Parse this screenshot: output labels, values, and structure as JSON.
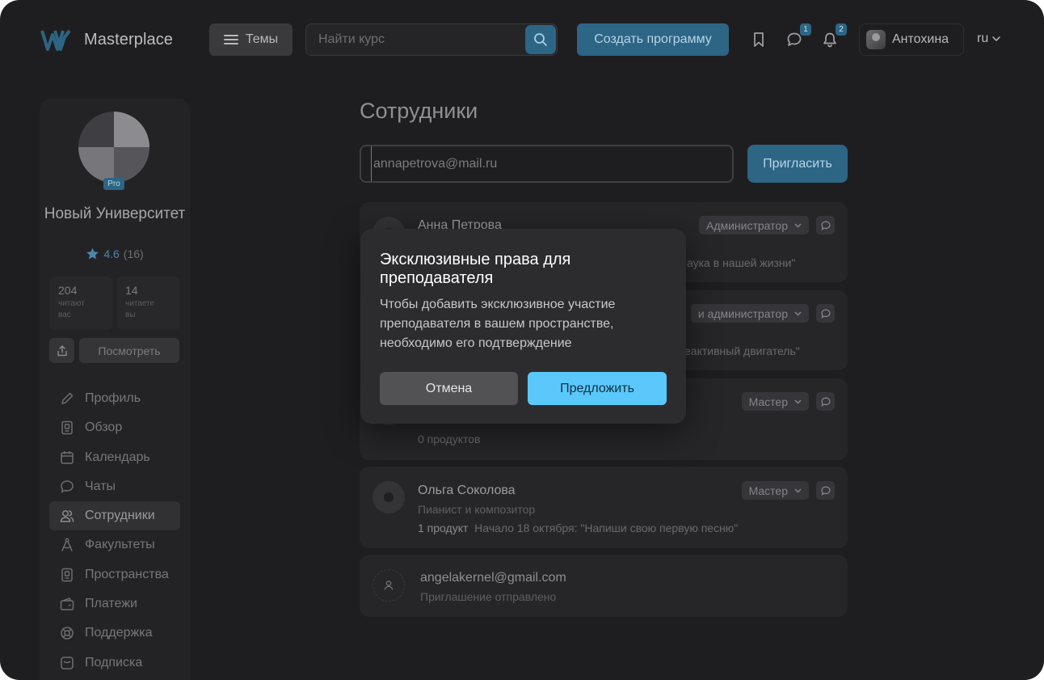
{
  "app": {
    "name": "Masterplace"
  },
  "header": {
    "themes_label": "Темы",
    "search_placeholder": "Найти курс",
    "create_label": "Создать программу",
    "messages_badge": "1",
    "notifications_badge": "2",
    "user_name": "Антохина",
    "lang": "ru"
  },
  "sidebar": {
    "pro_label": "Pro",
    "university_name": "Новый Университет",
    "rating": "4.6",
    "rating_count": "(16)",
    "stats": [
      {
        "num": "204",
        "label": "читают вас"
      },
      {
        "num": "14",
        "label": "читаете вы"
      }
    ],
    "view_label": "Посмотреть",
    "nav": [
      {
        "label": "Профиль",
        "icon": "pencil-icon"
      },
      {
        "label": "Обзор",
        "icon": "overview-icon"
      },
      {
        "label": "Календарь",
        "icon": "calendar-icon"
      },
      {
        "label": "Чаты",
        "icon": "chat-icon"
      },
      {
        "label": "Сотрудники",
        "icon": "users-icon",
        "active": true
      },
      {
        "label": "Факультеты",
        "icon": "compass-icon"
      },
      {
        "label": "Пространства",
        "icon": "space-icon"
      },
      {
        "label": "Платежи",
        "icon": "wallet-icon"
      },
      {
        "label": "Поддержка",
        "icon": "lifebuoy-icon"
      },
      {
        "label": "Подписка",
        "icon": "subscription-icon"
      }
    ]
  },
  "main": {
    "title": "Сотрудники",
    "invite_value": "annapetrova@mail.ru",
    "invite_label": "Пригласить",
    "employees": [
      {
        "name": "Анна Петрова",
        "role": "Администратор",
        "meta_tail": "аука в нашей жизни\""
      },
      {
        "role": "и администратор",
        "meta_tail": "еактивный двигатель\""
      },
      {
        "role": "Мастер",
        "meta_full": "0 продуктов"
      },
      {
        "name": "Ольга Соколова",
        "role": "Мастер",
        "subtitle": "Пианист и композитор",
        "products": "1 продукт",
        "meta": "Начало 18 октября: \"Напиши свою первую песню\""
      }
    ],
    "pending": {
      "email": "angelakernel@gmail.com",
      "status": "Приглашение отправлено"
    }
  },
  "modal": {
    "title": "Эксклюзивные права для преподавателя",
    "body": "Чтобы добавить эксклюзивное участие преподавателя в вашем пространстве, необходимо его подтверждение",
    "cancel_label": "Отмена",
    "confirm_label": "Предложить"
  },
  "colors": {
    "accent": "#5ac8fa",
    "accent_dim": "#2d6585",
    "background": "#1e1e20"
  }
}
